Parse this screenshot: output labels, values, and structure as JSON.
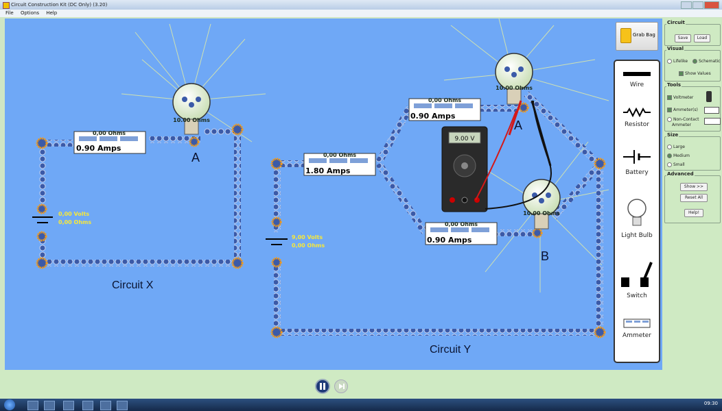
{
  "window": {
    "title": "Circuit Construction Kit (DC Only) (3.20)"
  },
  "menu": [
    "File",
    "Options",
    "Help"
  ],
  "grab_bag_label": "Grab Bag",
  "toolbox": {
    "wire": "Wire",
    "resistor": "Resistor",
    "battery": "Battery",
    "bulb": "Light Bulb",
    "switch": "Switch",
    "ammeter": "Ammeter"
  },
  "circuit_x": {
    "label": "Circuit X",
    "ammeter_ohms": "0,00 Ohms",
    "ammeter_amps": "0.90 Amps",
    "bulb_value": "10.00 Ohms",
    "bulb_label": "A",
    "battery_volts": "0,00 Volts",
    "battery_ohms": "0,00 Ohms"
  },
  "circuit_y": {
    "label": "Circuit Y",
    "main_ammeter_ohms": "0,00 Ohms",
    "main_ammeter_amps": "1.80 Amps",
    "top_ammeter_ohms": "0,00 Ohms",
    "top_ammeter_amps": "0.90 Amps",
    "bottom_ammeter_ohms": "0,00 Ohms",
    "bottom_ammeter_amps": "0.90 Amps",
    "bulb_a_value": "10.00 Ohms",
    "bulb_a_label": "A",
    "bulb_b_value": "10.00 Ohms",
    "bulb_b_label": "B",
    "battery_volts": "9,00 Volts",
    "battery_ohms": "0,00 Ohms",
    "voltmeter_reading": "9.00 V"
  },
  "panel": {
    "circuit": {
      "title": "Circuit",
      "save": "Save",
      "load": "Load"
    },
    "visual": {
      "title": "Visual",
      "lifelike": "Lifelike",
      "schematic": "Schematic",
      "show_values": "Show Values"
    },
    "tools": {
      "title": "Tools",
      "voltmeter": "Voltmeter",
      "ammeter": "Ammeter(s)",
      "noncontact_1": "Non-Contact",
      "noncontact_2": "Ammeter"
    },
    "size": {
      "title": "Size",
      "large": "Large",
      "medium": "Medium",
      "small": "Small"
    },
    "advanced": {
      "title": "Advanced",
      "show": "Show >>",
      "reset": "Reset All",
      "help": "Help!"
    }
  },
  "taskbar": {
    "clock": "09:30"
  },
  "colors": {
    "workspace": "#6fa8f6",
    "panel": "#cfeac3",
    "wire_bead": "#3b5aa8",
    "junction": "#f29a1a"
  }
}
